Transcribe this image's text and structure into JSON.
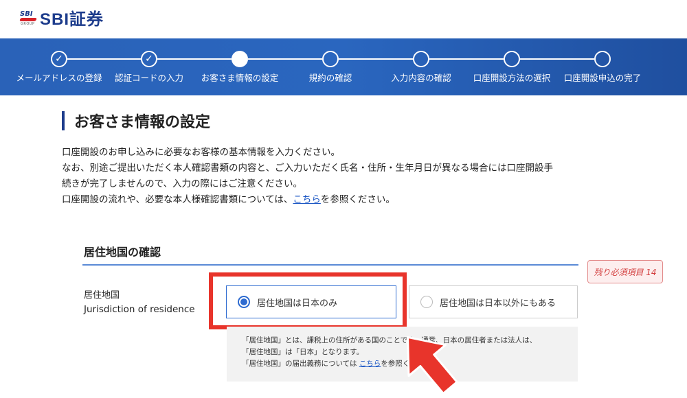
{
  "brand": {
    "logo_small": "SBI",
    "logo_group": "GROUP",
    "logo_text": "SBI証券"
  },
  "steps": [
    {
      "label": "メールアドレスの登録",
      "state": "done"
    },
    {
      "label": "認証コードの入力",
      "state": "done"
    },
    {
      "label": "お客さま情報の設定",
      "state": "current"
    },
    {
      "label": "規約の確認",
      "state": "todo"
    },
    {
      "label": "入力内容の確認",
      "state": "todo"
    },
    {
      "label": "口座開設方法の選択",
      "state": "todo"
    },
    {
      "label": "口座開設申込の完了",
      "state": "todo"
    }
  ],
  "page": {
    "title": "お客さま情報の設定",
    "intro_line1": "口座開設のお申し込みに必要なお客様の基本情報を入力ください。",
    "intro_line2": "なお、別途ご提出いただく本人確認書類の内容と、ご入力いただく氏名・住所・生年月日が異なる場合には口座開設手",
    "intro_line3": "続きが完了しませんので、入力の際にはご注意ください。",
    "intro_line4_pre": "口座開設の流れや、必要な本人様確認書類については、",
    "intro_link": "こちら",
    "intro_line4_post": "を参照ください。"
  },
  "section": {
    "title": "居住地国の確認",
    "required_badge": "残り必須項目 14",
    "field_label_ja": "居住地国",
    "field_label_en": "Jurisdiction of residence",
    "option_japan_only": "居住地国は日本のみ",
    "option_other": "居住地国は日本以外にもある",
    "selected": "option_japan_only"
  },
  "note": {
    "line1": "「居住地国」とは、課税上の住所がある国のことです。通常、日本の居住者または法人は、",
    "line2": "「居住地国」は「日本」となります。",
    "line3_pre": "「居住地国」の届出義務については ",
    "line3_link": "こちら",
    "line3_post": "を参照ください。"
  },
  "colors": {
    "brand_blue": "#1d3c8c",
    "stepbar_blue": "#2a62b8",
    "highlight_red": "#e8342b",
    "radio_blue": "#2e6bd0"
  }
}
